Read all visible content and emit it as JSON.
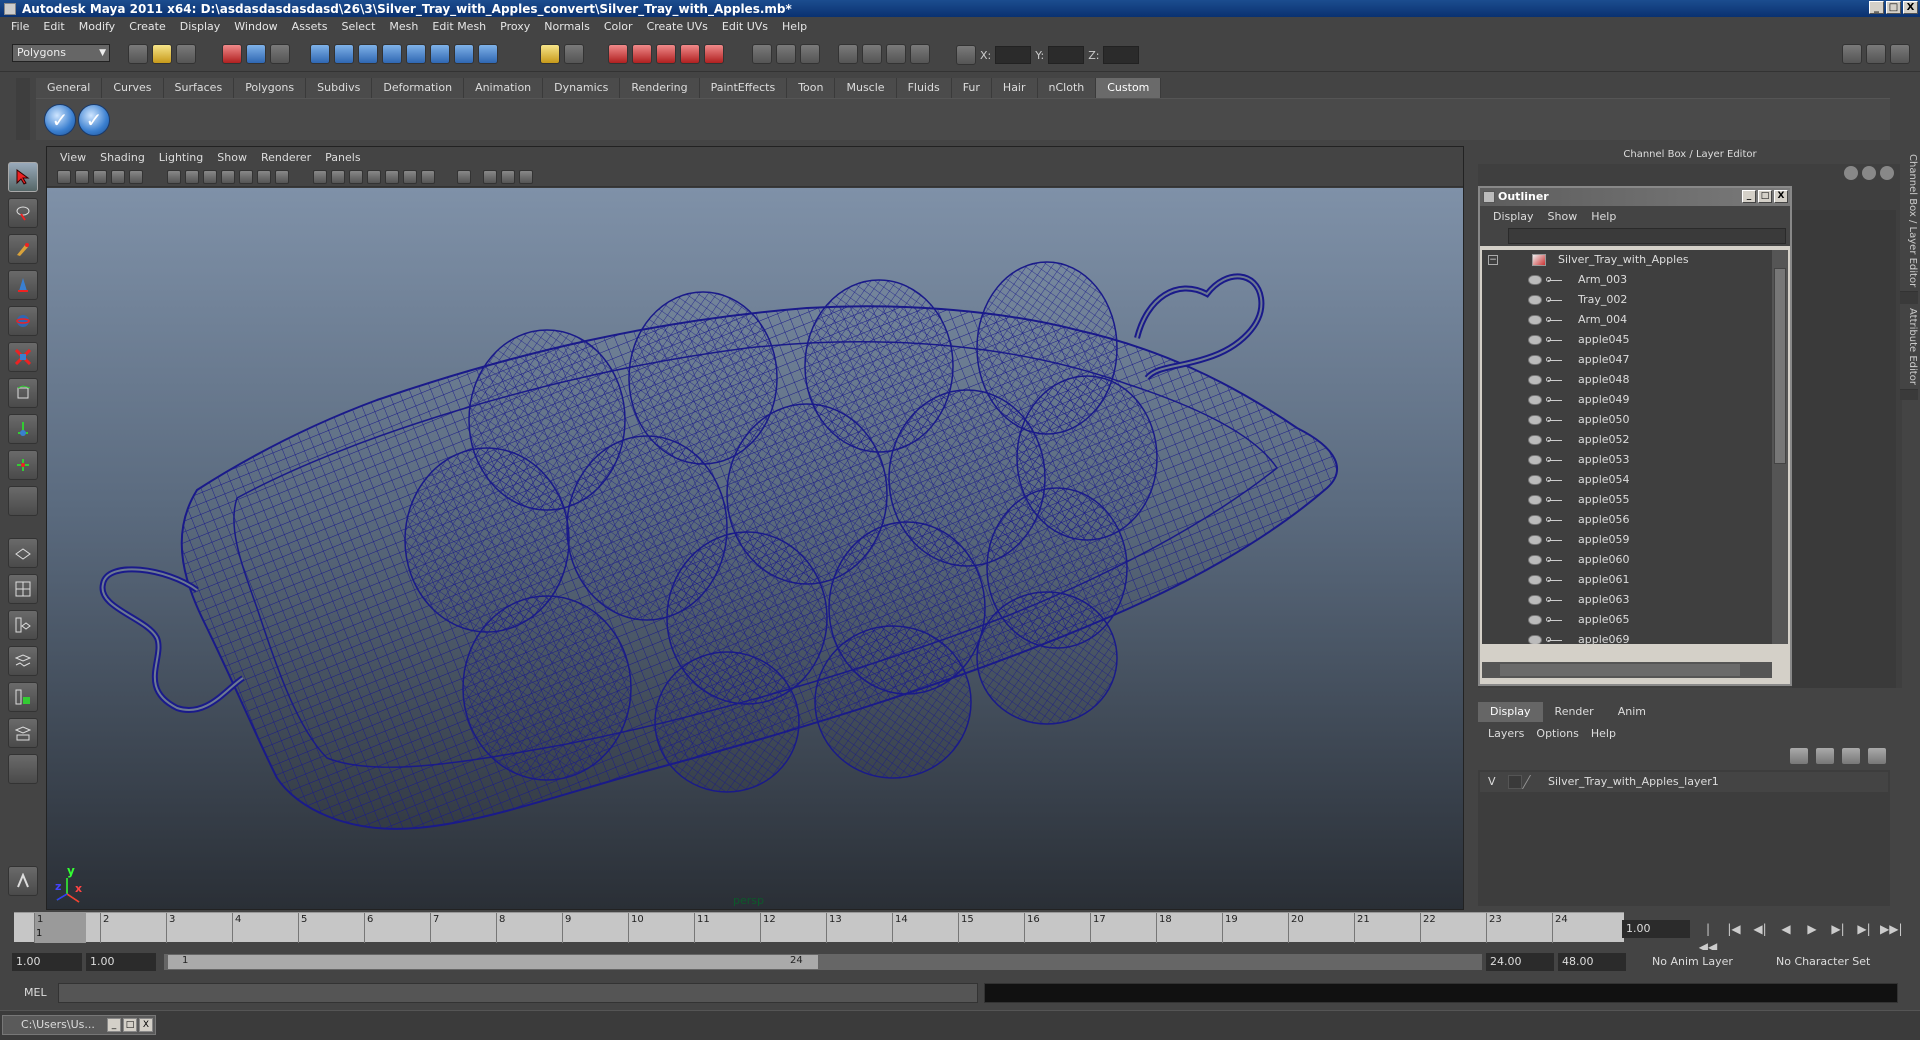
{
  "window": {
    "title": "Autodesk Maya 2011 x64: D:\\asdasdasdasdasd\\26\\3\\Silver_Tray_with_Apples_convert\\Silver_Tray_with_Apples.mb*",
    "minimize": "_",
    "maximize": "□",
    "close": "X"
  },
  "menubar": [
    "File",
    "Edit",
    "Modify",
    "Create",
    "Display",
    "Window",
    "Assets",
    "Select",
    "Mesh",
    "Edit Mesh",
    "Proxy",
    "Normals",
    "Color",
    "Create UVs",
    "Edit UVs",
    "Help"
  ],
  "statusline": {
    "mode": "Polygons",
    "x_label": "X:",
    "y_label": "Y:",
    "z_label": "Z:"
  },
  "shelf": {
    "tabs": [
      "General",
      "Curves",
      "Surfaces",
      "Polygons",
      "Subdivs",
      "Deformation",
      "Animation",
      "Dynamics",
      "Rendering",
      "PaintEffects",
      "Toon",
      "Muscle",
      "Fluids",
      "Fur",
      "Hair",
      "nCloth",
      "Custom"
    ],
    "active_tab": "Custom",
    "check_glyph": "✓"
  },
  "viewport": {
    "menu": [
      "View",
      "Shading",
      "Lighting",
      "Show",
      "Renderer",
      "Panels"
    ],
    "camera_label": "persp",
    "axis_y": "y",
    "axis_x": "x",
    "axis_z": "z",
    "wire_color": "#1a1a8a"
  },
  "channel_box": {
    "title": "Channel Box / Layer Editor"
  },
  "outliner": {
    "title": "Outliner",
    "menu": [
      "Display",
      "Show",
      "Help"
    ],
    "collapse": "−",
    "root": "Silver_Tray_with_Apples",
    "items": [
      "Arm_003",
      "Tray_002",
      "Arm_004",
      "apple045",
      "apple047",
      "apple048",
      "apple049",
      "apple050",
      "apple052",
      "apple053",
      "apple054",
      "apple055",
      "apple056",
      "apple059",
      "apple060",
      "apple061",
      "apple063",
      "apple065",
      "apple069"
    ]
  },
  "layer_editor": {
    "tabs": [
      "Display",
      "Render",
      "Anim"
    ],
    "active_tab": "Display",
    "menu": [
      "Layers",
      "Options",
      "Help"
    ],
    "layer_visible": "V",
    "layer_name": "Silver_Tray_with_Apples_layer1"
  },
  "side_tabs": [
    "Channel Box / Layer Editor",
    "Attribute Editor"
  ],
  "timeline": {
    "ticks": [
      "1",
      "2",
      "3",
      "4",
      "5",
      "6",
      "7",
      "8",
      "9",
      "10",
      "11",
      "12",
      "13",
      "14",
      "15",
      "16",
      "17",
      "18",
      "19",
      "20",
      "21",
      "22",
      "23",
      "24"
    ],
    "current_marker": "1",
    "current_frame": "1.00",
    "playback_glyphs": [
      "|◀◀",
      "|◀",
      "◀|",
      "◀",
      "▶",
      "▶|",
      "▶|",
      "▶▶|"
    ]
  },
  "range": {
    "start": "1.00",
    "playback_start": "1.00",
    "bar_start": "1",
    "bar_end": "24",
    "playback_end": "24.00",
    "end": "48.00",
    "anim_layer": "No Anim Layer",
    "character_set": "No Character Set"
  },
  "cmdline": {
    "label": "MEL"
  },
  "taskbar": {
    "item": "C:\\Users\\Us..."
  }
}
